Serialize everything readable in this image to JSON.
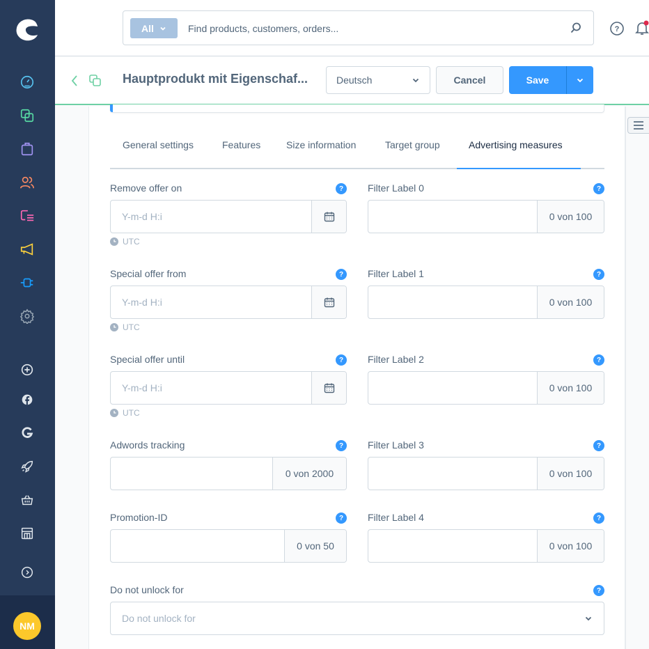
{
  "sidebar": {
    "main_nav": [
      {
        "name": "dashboard",
        "icon": "gauge-icon",
        "color": "#57c3f0"
      },
      {
        "name": "catalogues",
        "icon": "copy-icon",
        "color": "#57d9a3"
      },
      {
        "name": "orders",
        "icon": "shopping-bag-icon",
        "color": "#a092f0"
      },
      {
        "name": "customers",
        "icon": "users-icon",
        "color": "#f88962"
      },
      {
        "name": "content",
        "icon": "content-icon",
        "color": "#ff68b4"
      },
      {
        "name": "marketing",
        "icon": "megaphone-icon",
        "color": "#fdd13c"
      },
      {
        "name": "extensions",
        "icon": "plug-icon",
        "color": "#189eff"
      },
      {
        "name": "settings",
        "icon": "gear-icon",
        "color": "#9aa8b5"
      }
    ],
    "sales_channels": [
      {
        "name": "add-sales-channel",
        "icon": "plus-circle-icon"
      },
      {
        "name": "facebook",
        "icon": "facebook-icon"
      },
      {
        "name": "google",
        "icon": "google-icon"
      },
      {
        "name": "rocket",
        "icon": "rocket-icon"
      },
      {
        "name": "basket",
        "icon": "basket-icon"
      },
      {
        "name": "storefront",
        "icon": "storefront-icon"
      }
    ],
    "expand_icon": "chevron-right-circle-icon",
    "user_initials": "NM"
  },
  "topbar": {
    "search_type": "All",
    "search_placeholder": "Find products, customers, orders..."
  },
  "smartbar": {
    "title": "Hauptprodukt mit Eigenschaf...",
    "language": "Deutsch",
    "cancel_label": "Cancel",
    "save_label": "Save"
  },
  "tabs": [
    {
      "label": "General settings",
      "active": false
    },
    {
      "label": "Features",
      "active": false
    },
    {
      "label": "Size information",
      "active": false
    },
    {
      "label": "Target group",
      "active": false
    },
    {
      "label": "Advertising measures",
      "active": true
    }
  ],
  "left_fields": [
    {
      "label": "Remove offer on",
      "placeholder": "Y-m-d H:i",
      "hint": "UTC"
    },
    {
      "label": "Special offer from",
      "placeholder": "Y-m-d H:i",
      "hint": "UTC"
    },
    {
      "label": "Special offer until",
      "placeholder": "Y-m-d H:i",
      "hint": "UTC"
    },
    {
      "label": "Adwords tracking",
      "value": "",
      "counter": "0 von 2000"
    },
    {
      "label": "Promotion-ID",
      "value": "",
      "counter": "0 von 50"
    }
  ],
  "right_fields": [
    {
      "label": "Filter Label 0",
      "value": "",
      "counter": "0 von 100"
    },
    {
      "label": "Filter Label 1",
      "value": "",
      "counter": "0 von 100"
    },
    {
      "label": "Filter Label 2",
      "value": "",
      "counter": "0 von 100"
    },
    {
      "label": "Filter Label 3",
      "value": "",
      "counter": "0 von 100"
    },
    {
      "label": "Filter Label 4",
      "value": "",
      "counter": "0 von 100"
    }
  ],
  "unlock": {
    "label": "Do not unlock for",
    "placeholder": "Do not unlock for"
  },
  "help_glyph": "?",
  "colors": {
    "primary": "#3498fe",
    "sidebar_bg": "#273b5a",
    "accent_green": "#6ed0a4",
    "avatar": "#fcc82b"
  }
}
